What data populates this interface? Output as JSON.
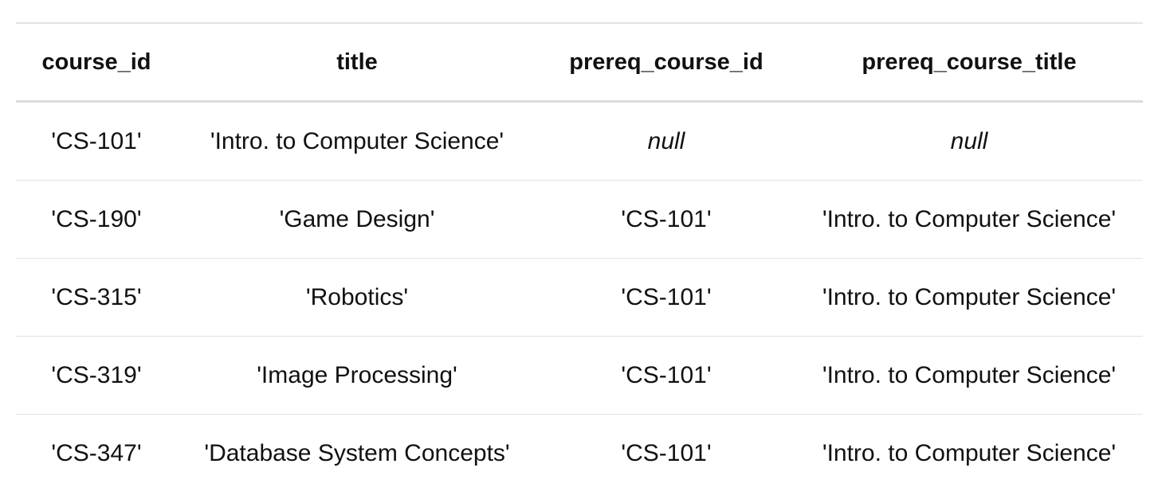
{
  "table": {
    "columns": [
      "course_id",
      "title",
      "prereq_course_id",
      "prereq_course_title"
    ],
    "rows": [
      [
        "'CS-101'",
        "'Intro. to Computer Science'",
        "null",
        "null"
      ],
      [
        "'CS-190'",
        "'Game Design'",
        "'CS-101'",
        "'Intro. to Computer Science'"
      ],
      [
        "'CS-315'",
        "'Robotics'",
        "'CS-101'",
        "'Intro. to Computer Science'"
      ],
      [
        "'CS-319'",
        "'Image Processing'",
        "'CS-101'",
        "'Intro. to Computer Science'"
      ],
      [
        "'CS-347'",
        "'Database System Concepts'",
        "'CS-101'",
        "'Intro. to Computer Science'"
      ]
    ]
  }
}
